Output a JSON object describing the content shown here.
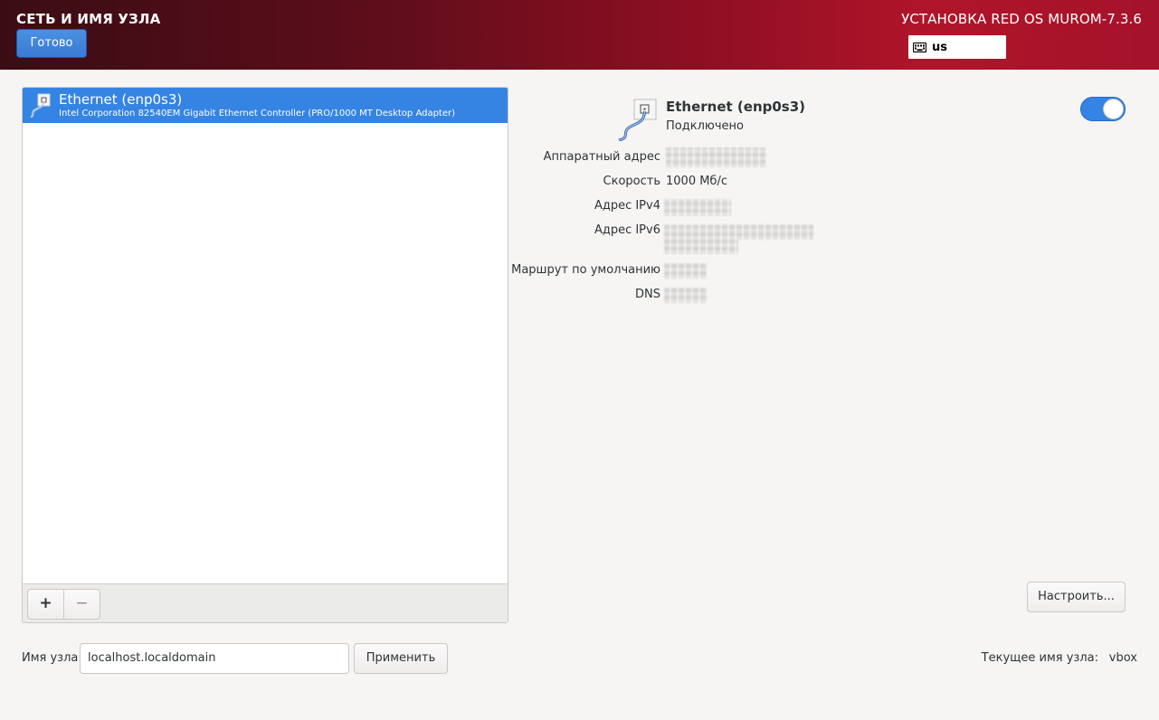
{
  "header": {
    "spoke_title": "СЕТЬ И ИМЯ УЗЛА",
    "done_label": "Готово",
    "product_title": "УСТАНОВКА RED OS MUROM-7.3.6",
    "keyboard_layout": "us",
    "keyboard_icon": "keyboard-icon"
  },
  "devices": {
    "items": [
      {
        "name": "Ethernet (enp0s3)",
        "description": "Intel Corporation 82540EM Gigabit Ethernet Controller (PRO/1000 MT Desktop Adapter)",
        "icon": "network-wired-icon",
        "selected": true
      }
    ],
    "add_label": "+",
    "remove_label": "−"
  },
  "detail": {
    "name": "Ethernet (enp0s3)",
    "status": "Подключено",
    "enabled": true,
    "properties": {
      "hw_label": "Аппаратный адрес",
      "speed_label": "Скорость",
      "speed_value": "1000 Мб/с",
      "ipv4_label": "Адрес IPv4",
      "ipv6_label": "Адрес IPv6",
      "route_label": "Маршрут по умолчанию",
      "dns_label": "DNS"
    },
    "configure_label": "Настроить..."
  },
  "hostname": {
    "label": "Имя узла:",
    "value": "localhost.localdomain",
    "apply_label": "Применить",
    "current_label": "Текущее имя узла:",
    "current_value": "vbox"
  },
  "colors": {
    "accent": "#3584e4",
    "header_dark": "#3a0d14",
    "header_red": "#b0142a"
  }
}
